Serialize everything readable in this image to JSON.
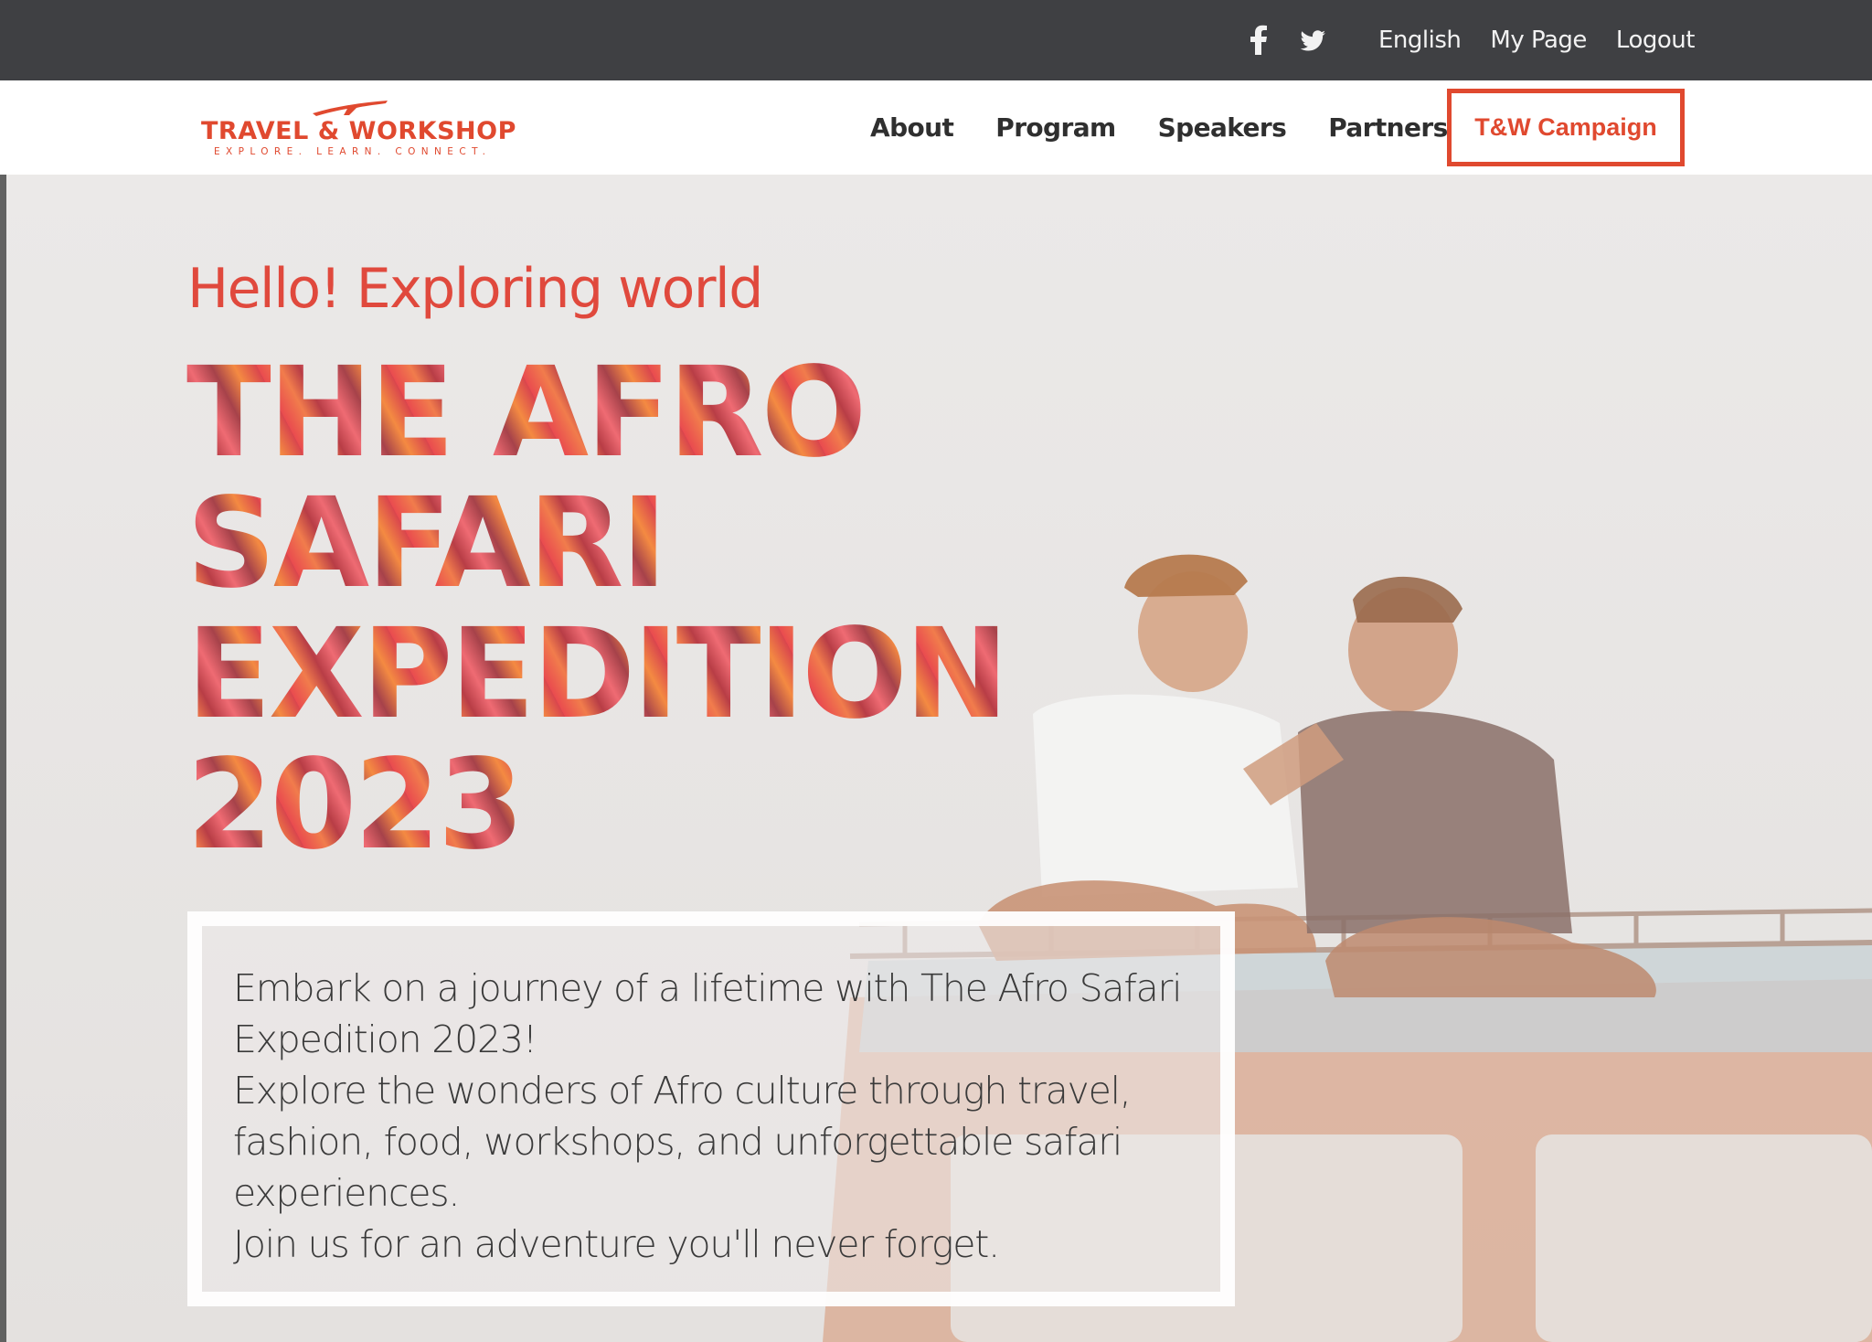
{
  "topbar": {
    "social": [
      "facebook-icon",
      "twitter-icon"
    ],
    "links": [
      "English",
      "My Page",
      "Logout"
    ]
  },
  "navbar": {
    "logo_main": "TRAVEL & WORKSHOP",
    "logo_sub": "EXPLORE. LEARN. CONNECT.",
    "links": [
      "About",
      "Program",
      "Speakers",
      "Partners"
    ],
    "campaign_label": "T&W Campaign"
  },
  "hero": {
    "greeting": "Hello! Exploring world",
    "headline": [
      "THE AFRO",
      "SAFARI",
      "EXPEDITION",
      "2023"
    ],
    "description": [
      "Embark on a journey of a lifetime with The Afro Safari",
      "Expedition 2023!",
      "Explore the wonders of Afro culture through travel,",
      "fashion, food, workshops, and unforgettable safari",
      "experiences.",
      "Join us for an adventure you'll never forget."
    ]
  },
  "colors": {
    "accent": "#e0492f",
    "topbar_bg": "#3f4043",
    "hero_bg": "#e8e6e5"
  }
}
